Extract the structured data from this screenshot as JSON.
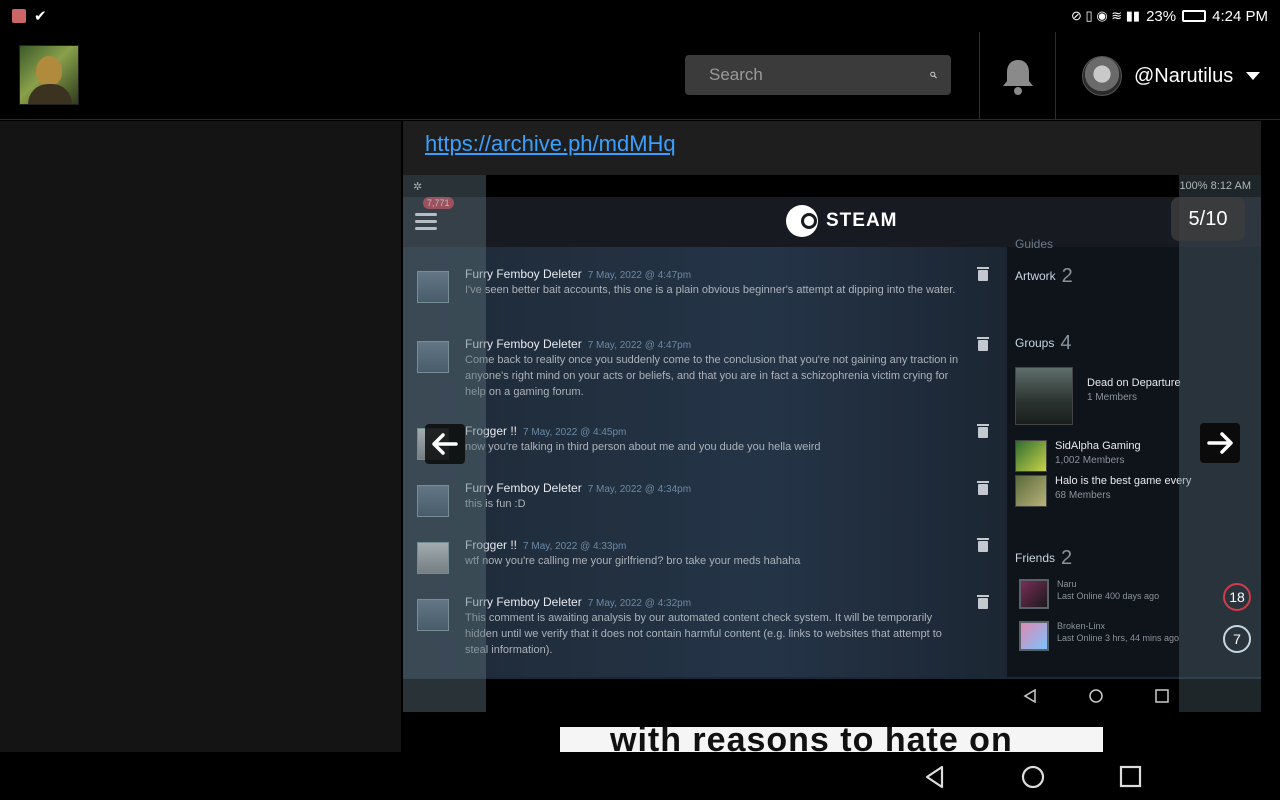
{
  "status_bar": {
    "battery": "23%",
    "time": "4:24 PM"
  },
  "header": {
    "search_placeholder": "Search",
    "username": "@Narutilus"
  },
  "post": {
    "link": "https://archive.ph/mdMHq",
    "image_counter": "5/10",
    "caption": "with reasons to hate on"
  },
  "steam_shot": {
    "status": {
      "battery": "100%",
      "time": "8:12 AM"
    },
    "logo": "STEAM",
    "menu_badge": "7,771",
    "comments": [
      {
        "author": "Furry Femboy Deleter",
        "date": "7 May, 2022 @ 4:47pm",
        "text": "I've seen better bait accounts, this one is a plain obvious beginner's attempt at dipping into the water."
      },
      {
        "author": "Furry Femboy Deleter",
        "date": "7 May, 2022 @ 4:47pm",
        "text": "Come back to reality once you suddenly come to the conclusion that you're not gaining any traction in anyone's right mind on your acts or beliefs, and that you are in fact a schizophrenia victim crying for help on a gaming forum."
      },
      {
        "author": "Frogger !!",
        "date": "7 May, 2022 @ 4:45pm",
        "text": "now you're talking in third person about me and you dude you hella weird"
      },
      {
        "author": "Furry Femboy Deleter",
        "date": "7 May, 2022 @ 4:34pm",
        "text": "this is fun :D"
      },
      {
        "author": "Frogger !!",
        "date": "7 May, 2022 @ 4:33pm",
        "text": "wtf now you're calling me your girlfriend? bro take your meds hahaha"
      },
      {
        "author": "Furry Femboy Deleter",
        "date": "7 May, 2022 @ 4:32pm",
        "text": "This comment is awaiting analysis by our automated content check system. It will be temporarily hidden until we verify that it does not contain harmful content (e.g. links to websites that attempt to steal information)."
      }
    ],
    "sidebar": {
      "guides_label": "Guides",
      "artwork_label": "Artwork",
      "artwork_count": "2",
      "groups_label": "Groups",
      "groups_count": "4",
      "groups": [
        {
          "name": "Dead on Departure",
          "members": "1 Members"
        },
        {
          "name": "SidAlpha Gaming",
          "members": "1,002 Members"
        },
        {
          "name": "Halo is the best game every",
          "members": "68 Members"
        }
      ],
      "friends_label": "Friends",
      "friends_count": "2",
      "friends": [
        {
          "name": "Naru",
          "status": "Last Online 400 days ago",
          "level": "18"
        },
        {
          "name": "Broken-Linx",
          "status": "Last Online 3 hrs, 44 mins ago",
          "level": "7"
        }
      ]
    }
  },
  "icons": [
    "bell-icon",
    "search-icon",
    "chevron-down-icon",
    "arrow-left-icon",
    "arrow-right-icon",
    "trash-icon",
    "back-icon",
    "home-icon",
    "recents-icon"
  ]
}
